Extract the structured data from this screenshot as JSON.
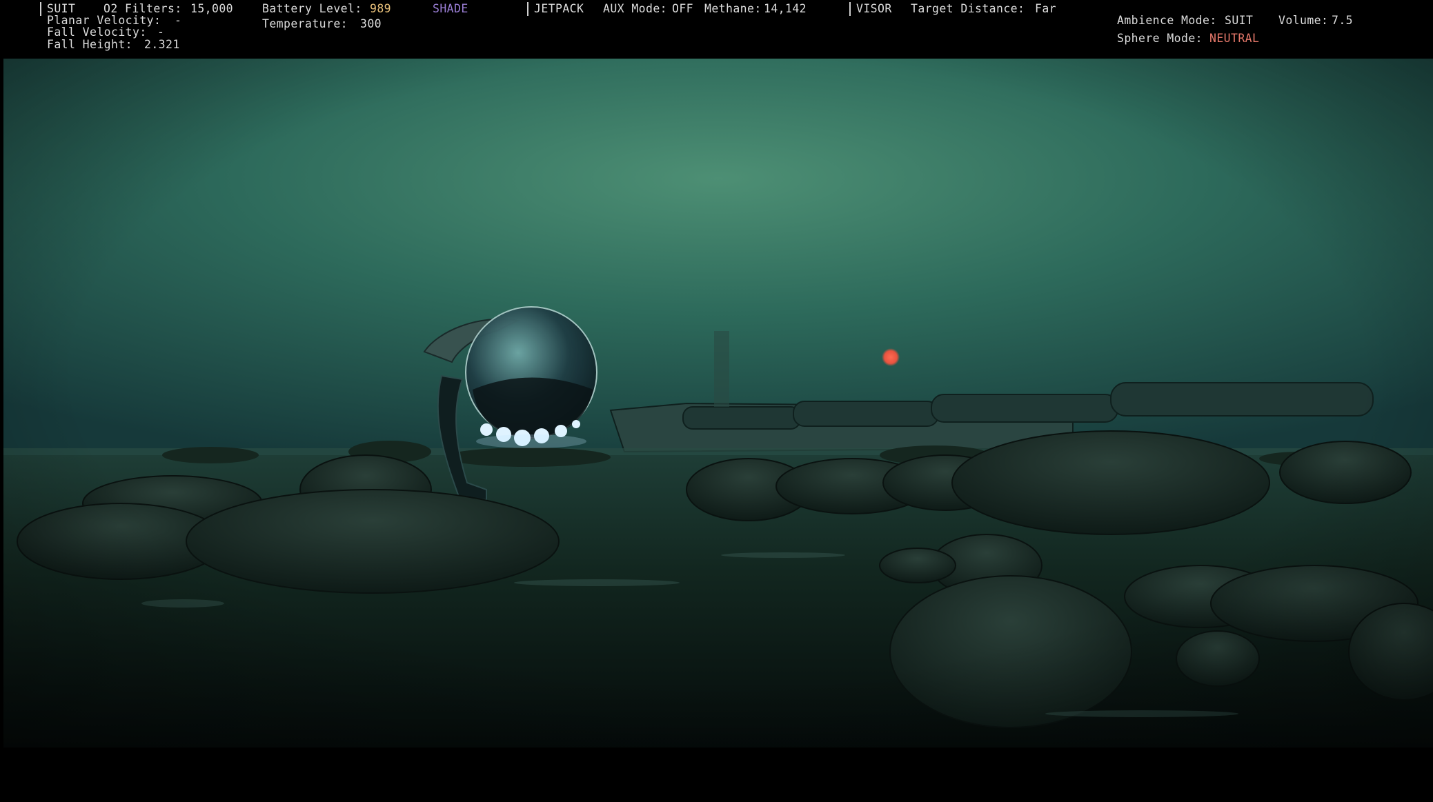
{
  "hud": {
    "suit": {
      "section_label": "SUIT",
      "o2_label": "O2 Filters:",
      "o2_value": "15,000",
      "planar_velocity_label": "Planar Velocity:",
      "planar_velocity_value": "-",
      "fall_velocity_label": "Fall Velocity:",
      "fall_velocity_value": "-",
      "fall_height_label": "Fall Height:",
      "fall_height_value": "2.321"
    },
    "battery": {
      "battery_label": "Battery Level:",
      "battery_value": "989",
      "temperature_label": "Temperature:",
      "temperature_value": "300",
      "shade_label": "SHADE"
    },
    "jetpack": {
      "section_label": "JETPACK",
      "aux_label": "AUX Mode:",
      "aux_value": "OFF",
      "methane_label": "Methane:",
      "methane_value": "14,142"
    },
    "visor": {
      "section_label": "VISOR",
      "target_label": "Target Distance:",
      "target_value": "Far"
    },
    "ambience": {
      "mode_label": "Ambience Mode:",
      "mode_value": "SUIT",
      "volume_label": "Volume:",
      "volume_value": "7.5",
      "sphere_label": "Sphere Mode:",
      "sphere_value": "NEUTRAL"
    }
  },
  "colors": {
    "hud_text": "#dcdcdc",
    "battery_value": "#e8c07a",
    "shade": "#9b7fd6",
    "sphere_mode": "#e6786a",
    "sky": "#2e6a5a",
    "water": "#0e1f1c",
    "sun": "#e8533f"
  },
  "scene": {
    "description_icons": [
      "glass-sphere-drone",
      "red-sun",
      "derelict-ship",
      "alien-rocks",
      "dark-water"
    ]
  }
}
